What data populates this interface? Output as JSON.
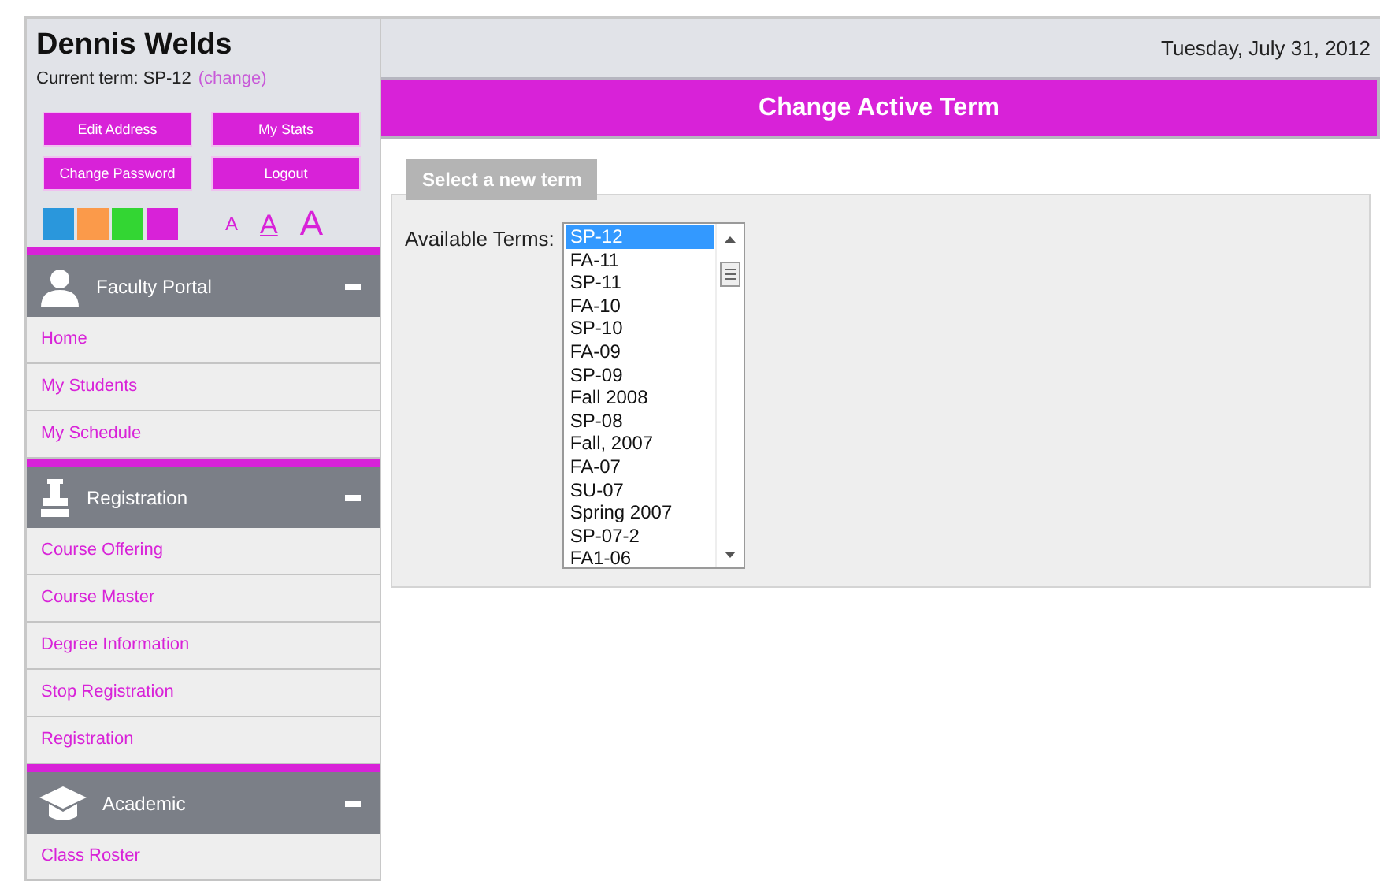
{
  "user": {
    "name": "Dennis Welds",
    "term_label": "Current term: SP-12",
    "change_link": "(change)"
  },
  "date": "Tuesday, July 31, 2012",
  "account_buttons": [
    "Edit Address",
    "My Stats",
    "Change Password",
    "Logout"
  ],
  "theme_swatches": [
    {
      "color": "#2a97dc"
    },
    {
      "color": "#fb9a4a"
    },
    {
      "color": "#33d633"
    },
    {
      "color": "#d822d8"
    }
  ],
  "font_sizes": [
    {
      "label": "A",
      "selected": false
    },
    {
      "label": "A",
      "selected": true
    },
    {
      "label": "A",
      "selected": false
    }
  ],
  "sections": [
    {
      "title": "Faculty Portal",
      "kind": "person",
      "expanded": true,
      "items": [
        "Home",
        "My Students",
        "My Schedule"
      ]
    },
    {
      "title": "Registration",
      "kind": "stamp",
      "expanded": true,
      "items": [
        "Course Offering",
        "Course Master",
        "Degree Information",
        "Stop Registration",
        "Registration"
      ]
    },
    {
      "title": "Academic",
      "kind": "cap",
      "expanded": true,
      "items": [
        "Class Roster"
      ]
    }
  ],
  "page_title": "Change Active Term",
  "panel": {
    "tab": "Select a new term",
    "field_label": "Available Terms:",
    "terms": [
      {
        "label": "SP-12",
        "selected": true
      },
      {
        "label": "FA-11",
        "selected": false
      },
      {
        "label": "SP-11",
        "selected": false
      },
      {
        "label": "FA-10",
        "selected": false
      },
      {
        "label": "SP-10",
        "selected": false
      },
      {
        "label": "FA-09",
        "selected": false
      },
      {
        "label": "SP-09",
        "selected": false
      },
      {
        "label": "Fall 2008",
        "selected": false
      },
      {
        "label": "SP-08",
        "selected": false
      },
      {
        "label": "Fall, 2007",
        "selected": false
      },
      {
        "label": "FA-07",
        "selected": false
      },
      {
        "label": "SU-07",
        "selected": false
      },
      {
        "label": "Spring 2007",
        "selected": false
      },
      {
        "label": "SP-07-2",
        "selected": false
      },
      {
        "label": "FA1-06",
        "selected": false
      }
    ]
  }
}
